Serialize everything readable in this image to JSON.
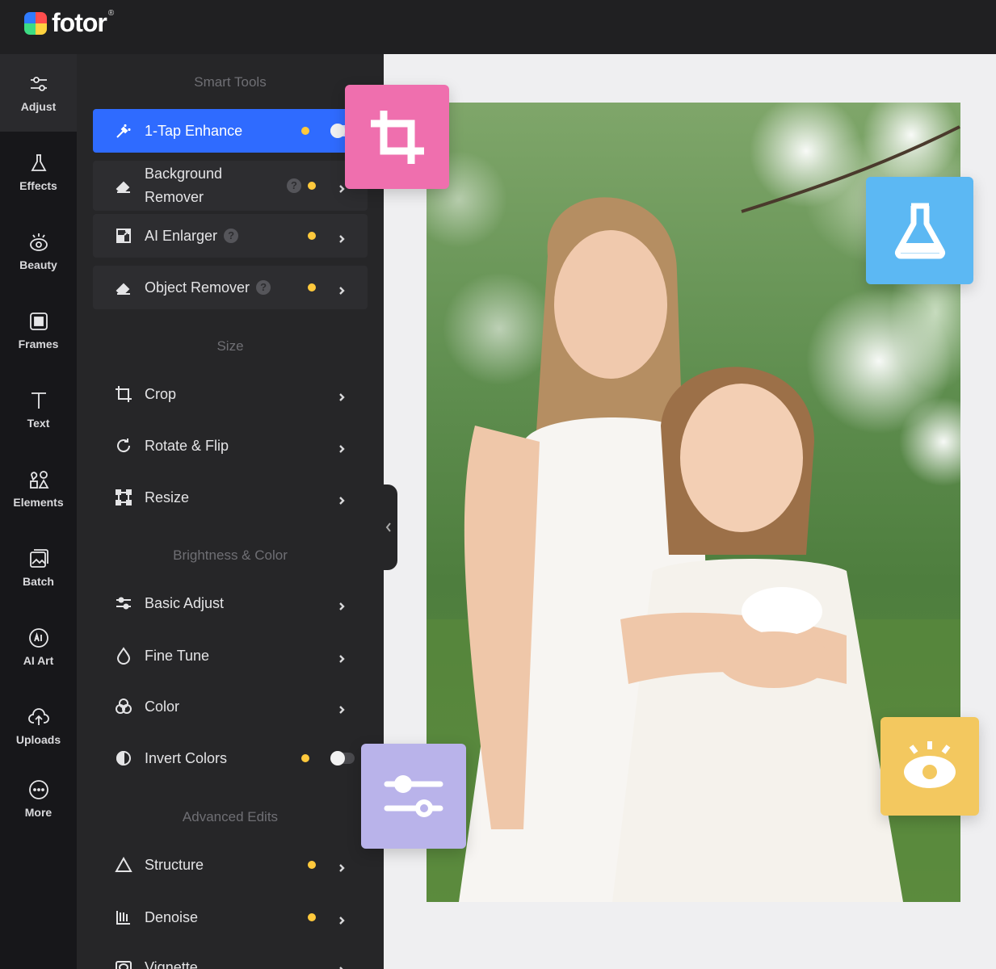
{
  "app": {
    "brand": "fotor",
    "brand_mark": "®"
  },
  "rail": {
    "items": [
      {
        "label": "Adjust",
        "icon": "sliders-icon",
        "active": true
      },
      {
        "label": "Effects",
        "icon": "flask-icon"
      },
      {
        "label": "Beauty",
        "icon": "eye-icon"
      },
      {
        "label": "Frames",
        "icon": "frame-icon"
      },
      {
        "label": "Text",
        "icon": "text-icon"
      },
      {
        "label": "Elements",
        "icon": "shapes-icon"
      },
      {
        "label": "Batch",
        "icon": "batch-icon"
      },
      {
        "label": "AI Art",
        "icon": "ai-icon"
      },
      {
        "label": "Uploads",
        "icon": "upload-icon"
      },
      {
        "label": "More",
        "icon": "more-icon"
      }
    ]
  },
  "panel": {
    "smart_tools": {
      "title": "Smart Tools",
      "items": [
        {
          "label": "1-Tap Enhance",
          "icon": "magic-wand-icon"
        },
        {
          "label": "Background Remover",
          "icon": "eraser-icon"
        },
        {
          "label": "AI Enlarger",
          "icon": "enlarge-icon"
        },
        {
          "label": "Object Remover",
          "icon": "eraser-icon"
        }
      ]
    },
    "size": {
      "title": "Size",
      "items": [
        {
          "label": "Crop",
          "icon": "crop-icon"
        },
        {
          "label": "Rotate & Flip",
          "icon": "rotate-icon"
        },
        {
          "label": "Resize",
          "icon": "resize-icon"
        }
      ]
    },
    "brightness": {
      "title": "Brightness & Color",
      "items": [
        {
          "label": "Basic Adjust",
          "icon": "sliders-icon"
        },
        {
          "label": "Fine Tune",
          "icon": "drop-icon"
        },
        {
          "label": "Color",
          "icon": "color-circles-icon"
        },
        {
          "label": "Invert Colors",
          "icon": "invert-icon"
        }
      ]
    },
    "advanced": {
      "title": "Advanced Edits",
      "items": [
        {
          "label": "Structure",
          "icon": "triangle-icon"
        },
        {
          "label": "Denoise",
          "icon": "denoise-icon"
        },
        {
          "label": "Vignette",
          "icon": "vignette-icon"
        }
      ]
    },
    "help_glyph": "?"
  },
  "colors": {
    "accent": "#2f6bff",
    "premium_dot": "#ffc93c",
    "crop_tile": "#ef6fae",
    "flask_tile": "#5cb8f3",
    "eye_tile": "#f3c85f",
    "adjust_tile": "#b9b3ea"
  }
}
